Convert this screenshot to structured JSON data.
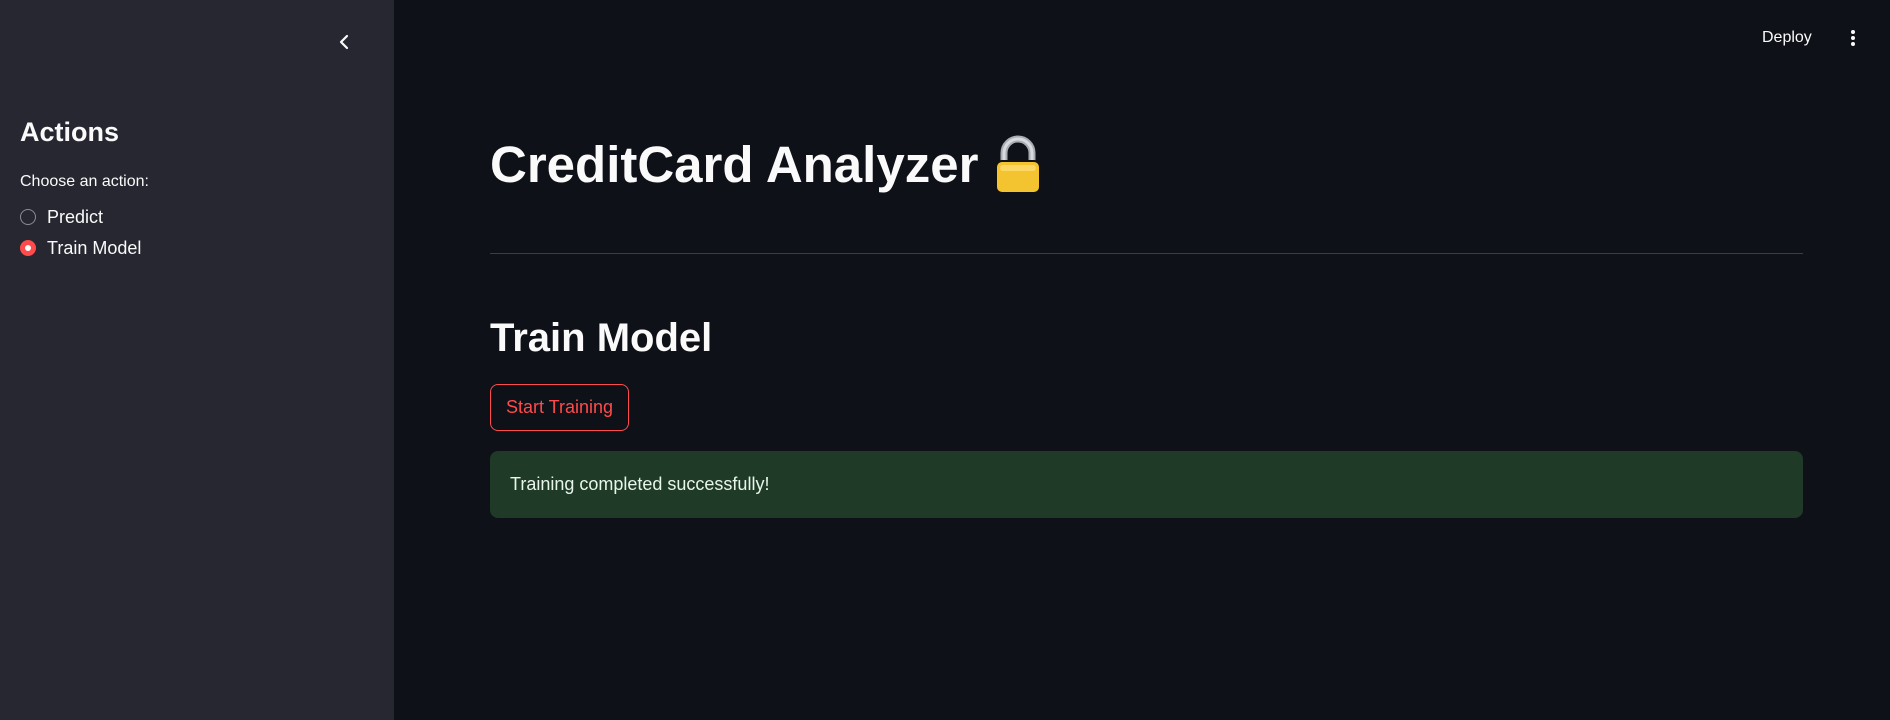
{
  "sidebar": {
    "title": "Actions",
    "radio_caption": "Choose an action:",
    "options": [
      {
        "label": "Predict",
        "checked": false
      },
      {
        "label": "Train Model",
        "checked": true
      }
    ],
    "collapse_icon": "chevron-left-icon"
  },
  "header": {
    "deploy_label": "Deploy",
    "menu_icon": "more-vertical-icon"
  },
  "main": {
    "title": "CreditCard Analyzer",
    "title_icon": "lock-icon",
    "section_title": "Train Model",
    "button_label": "Start Training",
    "success_message": "Training completed successfully!"
  },
  "colors": {
    "background": "#0e1117",
    "sidebar": "#262730",
    "accent": "#ff4b4b",
    "success_bg": "#1f3a27"
  }
}
